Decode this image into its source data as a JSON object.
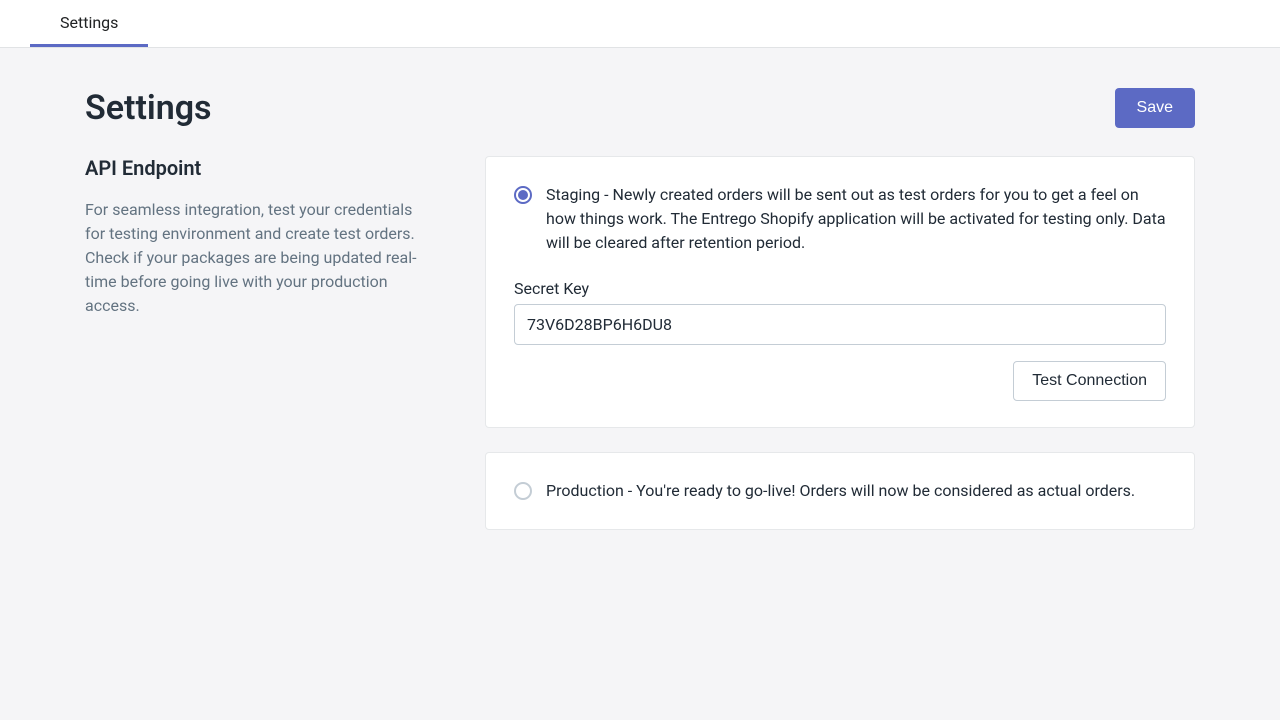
{
  "tabs": {
    "settings": "Settings"
  },
  "header": {
    "title": "Settings",
    "save_label": "Save"
  },
  "left": {
    "section_title": "API Endpoint",
    "section_desc": "For seamless integration, test your credentials for testing environment and create test orders. Check if your packages are being updated real-time before going live with your production access."
  },
  "staging": {
    "label": "Staging - Newly created orders will be sent out as test orders for you to get a feel on how things work. The Entrego Shopify application will be activated for testing only. Data will be cleared after retention period.",
    "secret_key_label": "Secret Key",
    "secret_key_value": "73V6D28BP6H6DU8",
    "test_connection_label": "Test Connection"
  },
  "production": {
    "label": "Production - You're ready to go-live! Orders will now be considered as actual orders."
  }
}
